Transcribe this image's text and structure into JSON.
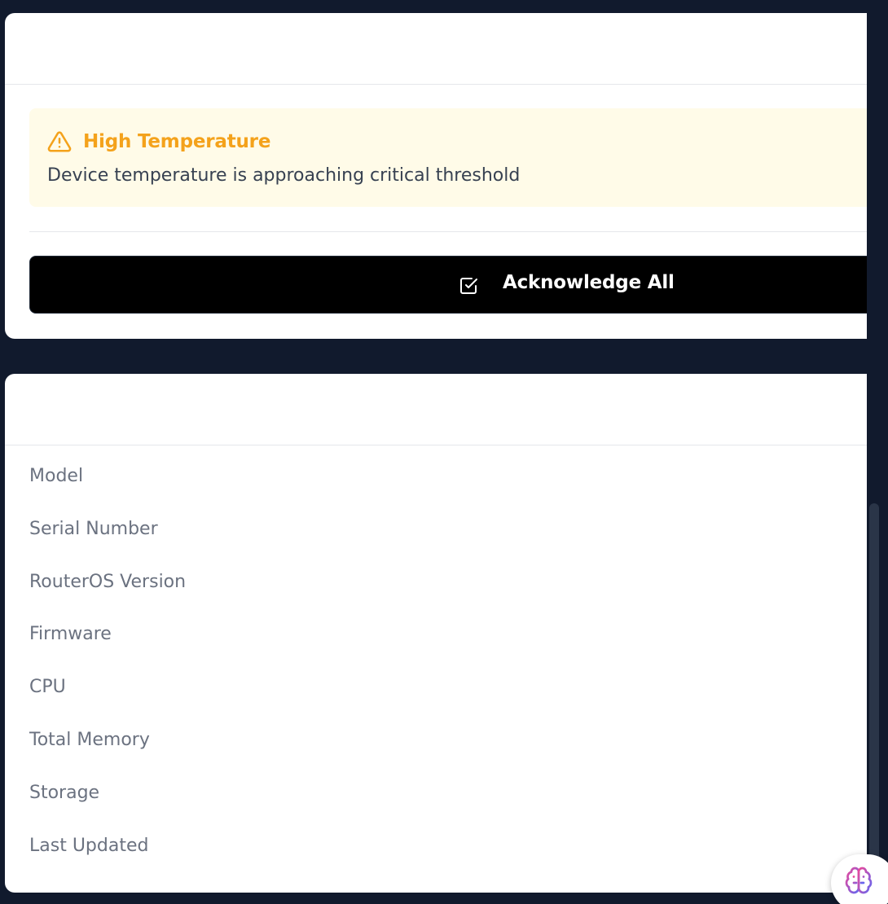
{
  "alerts": {
    "items": [
      {
        "icon": "warning-triangle-icon",
        "title": "High Temperature",
        "message": "Device temperature is approaching critical threshold",
        "color": "#f4a21b",
        "background": "#fffbe8"
      }
    ],
    "acknowledge_button": {
      "icon": "checkbox-icon",
      "label": "Acknowledge All"
    }
  },
  "device_info": {
    "rows": [
      {
        "label": "Model"
      },
      {
        "label": "Serial Number"
      },
      {
        "label": "RouterOS Version"
      },
      {
        "label": "Firmware"
      },
      {
        "label": "CPU"
      },
      {
        "label": "Total Memory"
      },
      {
        "label": "Storage"
      },
      {
        "label": "Last Updated"
      }
    ]
  },
  "assistant": {
    "icon": "brain-icon"
  },
  "colors": {
    "page_background": "#111a2d",
    "warning": "#f4a21b",
    "button": "#000000",
    "label_gray": "#6b7280"
  }
}
